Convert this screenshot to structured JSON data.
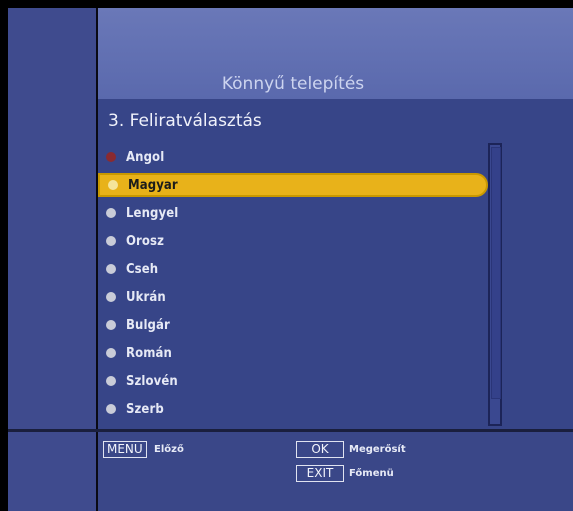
{
  "header": {
    "title": "Könnyű telepítés"
  },
  "step": {
    "title": "3. Feliratválasztás"
  },
  "languages": [
    {
      "label": "Angol"
    },
    {
      "label": "Magyar"
    },
    {
      "label": "Lengyel"
    },
    {
      "label": "Orosz"
    },
    {
      "label": "Cseh"
    },
    {
      "label": "Ukrán"
    },
    {
      "label": "Bulgár"
    },
    {
      "label": "Román"
    },
    {
      "label": "Szlovén"
    },
    {
      "label": "Szerb"
    }
  ],
  "footer": {
    "menu_key": "MENU",
    "menu_hint": "Előző",
    "ok_key": "OK",
    "ok_hint": "Megerősít",
    "exit_key": "EXIT",
    "exit_hint": "Főmenü"
  },
  "colors": {
    "accent": "#e8b21a",
    "active_dot": "#8a2a30"
  }
}
